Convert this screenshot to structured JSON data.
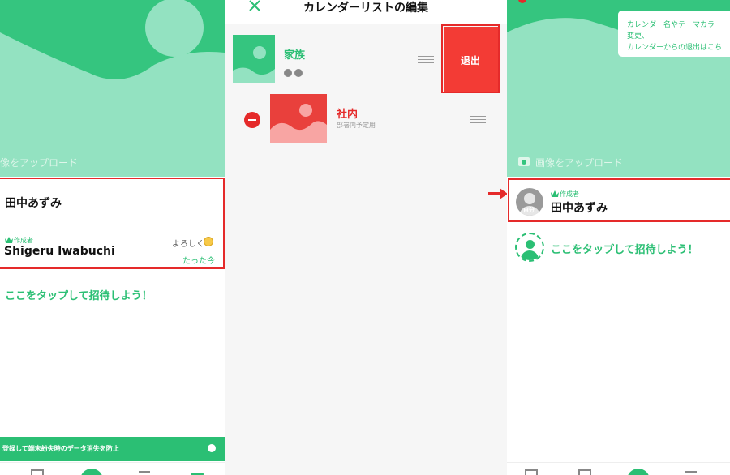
{
  "panel1": {
    "upload_label": "像をアップロード",
    "member1_name": "田中あずみ",
    "creator_badge": "作成者",
    "member2_name": "Shigeru Iwabuchi",
    "member2_message": "よろしく",
    "member2_time": "たった今",
    "invite_label": "ここをタップして招待しよう！",
    "banner_text": "登録して端末紛失時のデータ消失を防止"
  },
  "panel2": {
    "header_title": "カレンダーリストの編集",
    "cal1_name": "家族",
    "leave_button": "退出",
    "cal2_name": "社内",
    "cal2_sub": "部署内予定用"
  },
  "panel3": {
    "tooltip_line1": "カレンダー名やテーマカラー",
    "tooltip_line2": "変更、",
    "tooltip_line3": "カレンダーからの退出はこち",
    "upload_label": "画像をアップロード",
    "creator_badge": "作成者",
    "member_name": "田中あずみ",
    "avatar_label": "自分",
    "invite_label": "ここをタップして招待しよう！"
  },
  "colors": {
    "accent": "#2bbf74",
    "header_bg": "#35c57f",
    "hill_light": "#93e2c1",
    "highlight": "#e52a2a",
    "leave_bg": "#f33b35"
  },
  "icons": [
    "camera-icon",
    "crown-icon",
    "close-icon",
    "minus-circle-icon",
    "drag-handle-icon",
    "smile-emoji-icon",
    "plus-icon",
    "person-icon"
  ]
}
